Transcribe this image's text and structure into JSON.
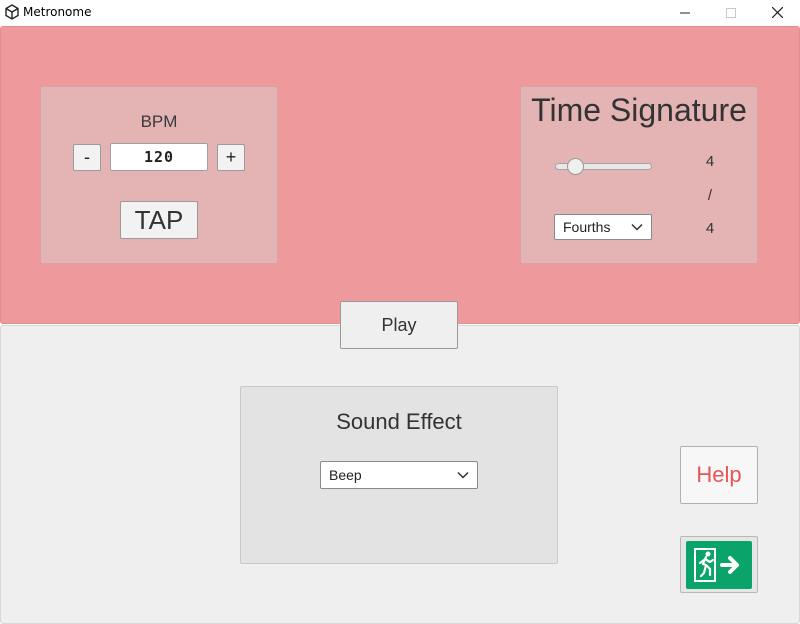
{
  "window": {
    "title": "Metronome"
  },
  "bpm": {
    "label": "BPM",
    "minus_label": "-",
    "plus_label": "+",
    "value": "120",
    "tap_label": "TAP"
  },
  "time_signature": {
    "title": "Time Signature",
    "beats": "4",
    "slider_fraction": 0.15,
    "separator": "/",
    "note_value": "4",
    "note_select_value": "Fourths"
  },
  "play": {
    "label": "Play"
  },
  "sound": {
    "title": "Sound Effect",
    "selected": "Beep"
  },
  "help": {
    "label": "Help"
  },
  "exit": {
    "icon": "emergency-exit-icon"
  },
  "colors": {
    "top_bg": "#ee9a9c",
    "panel_bg": "#e4b4b5",
    "bottom_bg": "#efefef",
    "help_text": "#e85555",
    "exit_green": "#0aa36a"
  }
}
